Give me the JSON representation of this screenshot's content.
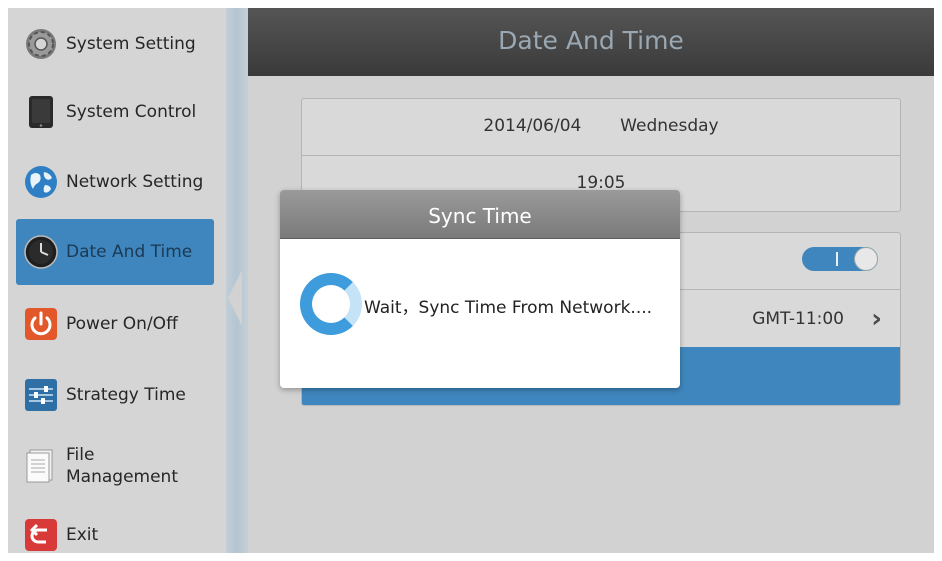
{
  "sidebar": {
    "items": [
      {
        "label": "System Setting",
        "icon": "gear-icon"
      },
      {
        "label": "System Control",
        "icon": "tablet-icon"
      },
      {
        "label": "Network Setting",
        "icon": "globe-icon"
      },
      {
        "label": "Date And Time",
        "icon": "clock-icon",
        "active": true
      },
      {
        "label": "Power On/Off",
        "icon": "power-icon"
      },
      {
        "label": "Strategy Time",
        "icon": "sliders-icon"
      },
      {
        "label": "File",
        "label2": "Management",
        "icon": "document-icon"
      },
      {
        "label": "Exit",
        "icon": "exit-icon"
      }
    ]
  },
  "header": {
    "title": "Date And Time"
  },
  "datetime": {
    "date": "2014/06/04",
    "weekday": "Wednesday",
    "time": "19:05"
  },
  "settings": {
    "toggle_on": true,
    "timezone": "GMT-11:00"
  },
  "dialog": {
    "title": "Sync Time",
    "message": "Wait，Sync Time From Network...."
  },
  "colors": {
    "accent": "#3e86bd",
    "header": "#444444",
    "sidebar": "#d5d5d5",
    "dialog_header": "#888888"
  }
}
